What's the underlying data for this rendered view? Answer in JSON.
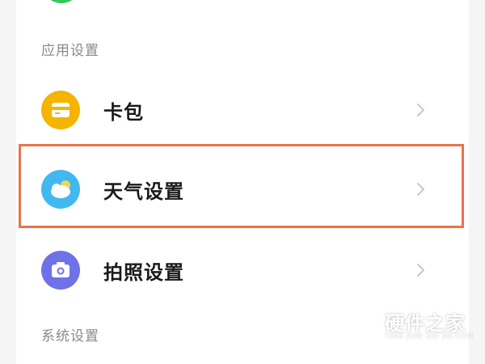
{
  "sections": {
    "app_settings_header": "应用设置",
    "system_settings_header": "系统设置"
  },
  "rows": [
    {
      "label": "卡包",
      "icon": "card-wallet-icon",
      "color": "#f5b400"
    },
    {
      "label": "天气设置",
      "icon": "weather-icon",
      "color": "#42b8f0"
    },
    {
      "label": "拍照设置",
      "icon": "camera-icon",
      "color": "#6f71e8"
    }
  ],
  "highlight_color": "#e8744a",
  "watermark": {
    "title": "硬件之家",
    "subtitle": "YING JIAN ZHI JIA.COM"
  }
}
